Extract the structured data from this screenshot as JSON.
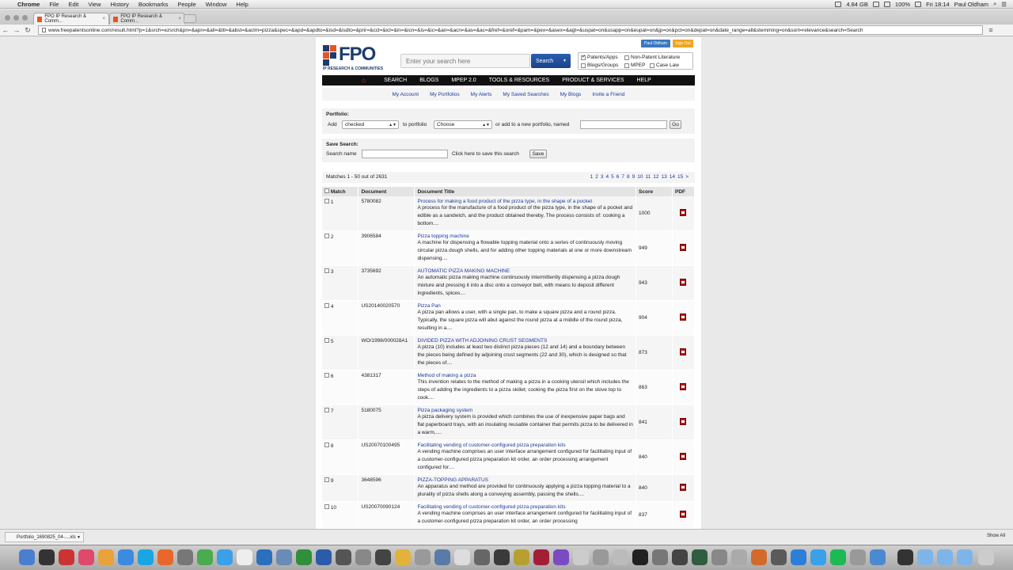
{
  "menubar": {
    "app": "Chrome",
    "items": [
      "File",
      "Edit",
      "View",
      "History",
      "Bookmarks",
      "People",
      "Window",
      "Help"
    ],
    "memory": "4.84 GB",
    "battery": "100%",
    "clock": "Fri 18:14",
    "user": "Paul Oldham"
  },
  "tabs": [
    {
      "label": "FPO IP Research & Comm..."
    },
    {
      "label": "FPO IP Research & Comm..."
    }
  ],
  "address": {
    "url": "www.freepatentsonline.com/result.html?p=1&srch=ezsrch&pn=&apn=&all=&ttl=&abst=&aclm=pizza&spec=&apd=&apdto=&isd=&isdto=&prir=&ccl=&icl=&in=&icn=&is=&ic=&an=&acn=&as=&ac=&fref=&oref=&pam=&pex=&asex=&agt=&uspat=on&usapp=on&eupat=on&jp=on&pct=on&depat=on&date_range=all&stemming=on&sort=relevance&search=Search"
  },
  "header": {
    "logo_text": "FPO",
    "logo_sub": "IP RESEARCH & COMMUNITIES",
    "search_placeholder": "Enter your search here",
    "search_button": "Search",
    "user_button": "Paul Oldham",
    "signout_button": "Sign Out",
    "filters": [
      {
        "label": "Patents/Apps",
        "checked": true
      },
      {
        "label": "Non-Patent Literature",
        "checked": false
      },
      {
        "label": "Blogs/Groups",
        "checked": false
      },
      {
        "label": "MPEP",
        "checked": false
      },
      {
        "label": "Case Law",
        "checked": false
      }
    ]
  },
  "mainnav": [
    "SEARCH",
    "BLOGS",
    "MPEP 2.0",
    "TOOLS & RESOURCES",
    "PRODUCT & SERVICES",
    "HELP"
  ],
  "subnav": [
    "My Account",
    "My Portfolios",
    "My Alerts",
    "My Saved Searches",
    "My Blogs",
    "Invite a Friend"
  ],
  "portfolio": {
    "heading": "Portfolio:",
    "add_label": "Add",
    "add_value": "checked",
    "to_label": "to portfolio",
    "to_value": "Choose",
    "new_label": "or add to a new portfolio, named",
    "go_button": "Go"
  },
  "save_search": {
    "heading": "Save Search:",
    "name_label": "Search name",
    "hint": "Click here to save this search",
    "save_button": "Save"
  },
  "results_info": {
    "count_text": "Matches 1 - 50 out of 2631",
    "pages": [
      "1",
      "2",
      "3",
      "4",
      "5",
      "6",
      "7",
      "8",
      "9",
      "10",
      "11",
      "12",
      "13",
      "14",
      "15",
      ">"
    ]
  },
  "table": {
    "headers": [
      "Match",
      "Document",
      "Document Title",
      "Score",
      "PDF"
    ],
    "rows": [
      {
        "match": "1",
        "doc": "5780082",
        "title": "Process for making a food product of the pizza type, in the shape of a pocket",
        "snippet": "A process for the manufacture of a food product of the pizza type, in the shape of a pocket and edible as a sandwich, and the product obtained thereby. The process consists of: cooking a bottom....",
        "score": "1000"
      },
      {
        "match": "2",
        "doc": "3906584",
        "title": "Pizza topping machine",
        "snippet": "A machine for dispensing a flowable topping material onto a series of continuously moving circular pizza dough shells, and for adding other topping materials at one or more downstream dispensing....",
        "score": "949"
      },
      {
        "match": "3",
        "doc": "3735692",
        "title": "AUTOMATIC PIZZA MAKING MACHINE",
        "snippet": "An automatic pizza making machine continuously intermittently dispensing a pizza dough mixture and pressing it into a disc onto a conveyor belt, with means to deposit different ingredients, spices....",
        "score": "943"
      },
      {
        "match": "4",
        "doc": "US20140020570",
        "title": "Pizza Pan",
        "snippet": "A pizza pan allows a user, with a single pan, to make a square pizza and a round pizza. Typically, the square pizza will abut against the round pizza at a middle of the round pizza, resulting in a....",
        "score": "904"
      },
      {
        "match": "5",
        "doc": "WO/1998/000028A1",
        "title": "DIVIDED PIZZA WITH ADJOINING CRUST SEGMENTS",
        "snippet": "A pizza (10) includes at least two distinct pizza pieces (12 and 14) and a boundary between the pieces being defined by adjoining crust segments (22 and 30), which is designed so that the pieces of....",
        "score": "873"
      },
      {
        "match": "6",
        "doc": "4381317",
        "title": "Method of making a pizza",
        "snippet": "This invention relates to the method of making a pizza in a cooking utensil which includes the steps of adding the ingredients to a pizza skillet; cooking the pizza first on the stove top to cook....",
        "score": "863"
      },
      {
        "match": "7",
        "doc": "5180075",
        "title": "Pizza packaging system",
        "snippet": "A pizza delivery system is provided which combines the use of inexpensive paper bags and flat paperboard trays, with an insulating reusable container that permits pizza to be delivered in a warm,....",
        "score": "841"
      },
      {
        "match": "8",
        "doc": "US20070100495",
        "title": "Facilitating vending of customer-configured pizza preparation kits",
        "snippet": "A vending machine comprises an user interface arrangement configured for facilitating input of a customer-configured pizza preparation kit order, an order processing arrangement configured for....",
        "score": "840"
      },
      {
        "match": "9",
        "doc": "3648596",
        "title": "PIZZA-TOPPING APPARATUS",
        "snippet": "An apparatus and method are provided for continuously applying a pizza topping material to a plurality of pizza shells along a conveying assembly, passing the shells....",
        "score": "840"
      },
      {
        "match": "10",
        "doc": "US20070090124",
        "title": "Facilitating vending of customer-configured pizza preparation kits",
        "snippet": "A vending machine comprises an user interface arrangement configured for facilitating input of a customer-configured pizza preparation kit order, an order processing",
        "score": "837"
      }
    ]
  },
  "download": {
    "file": "Portfolio_1690825_04-....xls",
    "show_all": "Show All"
  },
  "colors": {
    "brand_blue": "#1d3b6e",
    "link_blue": "#1d3b9e",
    "accent_orange": "#e8541f",
    "nav_black": "#111111"
  }
}
